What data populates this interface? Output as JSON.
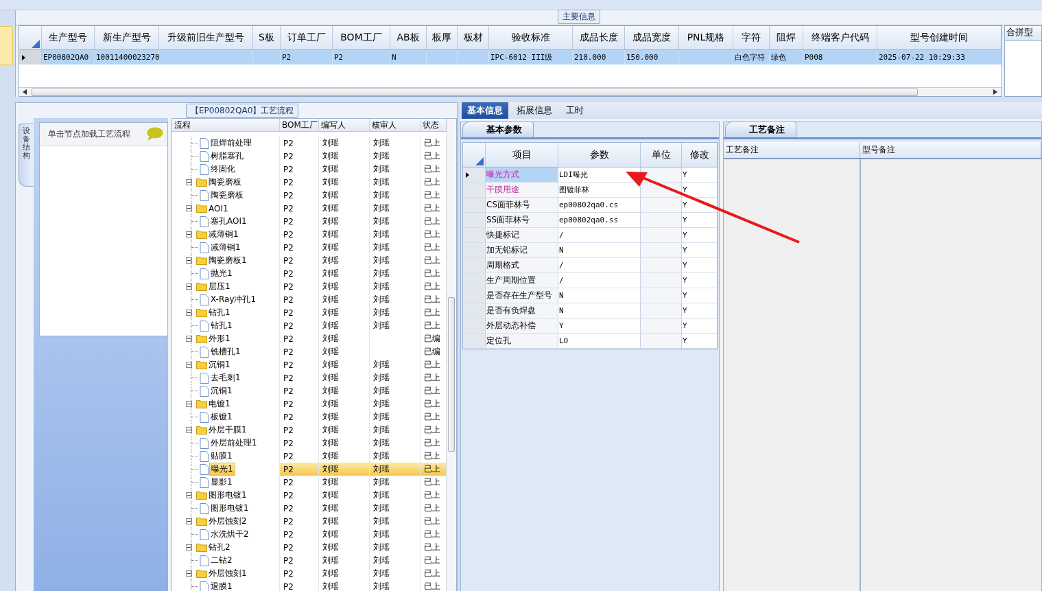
{
  "main_info": {
    "legend": "主要信息",
    "side_header": "合拼型",
    "columns": [
      "生产型号",
      "新生产型号",
      "升级前旧生产型号",
      "S板",
      "订单工厂",
      "BOM工厂",
      "AB板",
      "板厚",
      "板材",
      "验收标准",
      "成品长度",
      "成品宽度",
      "PNL规格",
      "字符",
      "阻焊",
      "终端客户代码",
      "型号创建时间"
    ],
    "rows": [
      {
        "selected": true,
        "cells": [
          "EP00802QA0",
          "10011400023270",
          null,
          null,
          "P2",
          "P2",
          "N",
          null,
          null,
          "IPC-6012 III级",
          "210.000",
          "150.000",
          null,
          "白色字符",
          "绿色",
          "P008",
          "2025-07-22 10:29:33"
        ]
      }
    ]
  },
  "process": {
    "legend": "【EP00802QA0】工艺流程",
    "side_tab": "设备结构",
    "hint": "单击节点加载工艺流程",
    "columns": [
      "流程",
      "BOM工厂",
      "编写人",
      "核审人",
      "状态"
    ],
    "tree": [
      {
        "children": [
          {
            "label": "阻焊前处理",
            "bom": "P2",
            "writer": "刘瑶",
            "reviewer": "刘瑶",
            "status": "已上",
            "selected": false
          },
          {
            "label": "树脂塞孔",
            "bom": "P2",
            "writer": "刘瑶",
            "reviewer": "刘瑶",
            "status": "已上",
            "selected": false
          },
          {
            "label": "终固化",
            "bom": "P2",
            "writer": "刘瑶",
            "reviewer": "刘瑶",
            "status": "已上",
            "selected": false
          }
        ]
      },
      {
        "label": "陶瓷磨板",
        "bom": "P2",
        "writer": "刘瑶",
        "reviewer": "刘瑶",
        "status": "已上",
        "selected": false,
        "expanded": true,
        "children": [
          {
            "label": "陶瓷磨板",
            "bom": "P2",
            "writer": "刘瑶",
            "reviewer": "刘瑶",
            "status": "已上",
            "selected": false
          }
        ]
      },
      {
        "label": "AOI1",
        "bom": "P2",
        "writer": "刘瑶",
        "reviewer": "刘瑶",
        "status": "已上",
        "selected": false,
        "expanded": true,
        "children": [
          {
            "label": "塞孔AOI1",
            "bom": "P2",
            "writer": "刘瑶",
            "reviewer": "刘瑶",
            "status": "已上",
            "selected": false
          }
        ]
      },
      {
        "label": "减薄铜1",
        "bom": "P2",
        "writer": "刘瑶",
        "reviewer": "刘瑶",
        "status": "已上",
        "selected": false,
        "expanded": true,
        "children": [
          {
            "label": "减薄铜1",
            "bom": "P2",
            "writer": "刘瑶",
            "reviewer": "刘瑶",
            "status": "已上",
            "selected": false
          }
        ]
      },
      {
        "label": "陶瓷磨板1",
        "bom": "P2",
        "writer": "刘瑶",
        "reviewer": "刘瑶",
        "status": "已上",
        "selected": false,
        "expanded": true,
        "children": [
          {
            "label": "抛光1",
            "bom": "P2",
            "writer": "刘瑶",
            "reviewer": "刘瑶",
            "status": "已上",
            "selected": false
          }
        ]
      },
      {
        "label": "层压1",
        "bom": "P2",
        "writer": "刘瑶",
        "reviewer": "刘瑶",
        "status": "已上",
        "selected": false,
        "expanded": true,
        "children": [
          {
            "label": "X-Ray冲孔1",
            "bom": "P2",
            "writer": "刘瑶",
            "reviewer": "刘瑶",
            "status": "已上",
            "selected": false
          }
        ]
      },
      {
        "label": "钻孔1",
        "bom": "P2",
        "writer": "刘瑶",
        "reviewer": "刘瑶",
        "status": "已上",
        "selected": false,
        "expanded": true,
        "children": [
          {
            "label": "钻孔1",
            "bom": "P2",
            "writer": "刘瑶",
            "reviewer": "刘瑶",
            "status": "已上",
            "selected": false
          }
        ]
      },
      {
        "label": "外形1",
        "bom": "P2",
        "writer": "刘瑶",
        "status": "已编",
        "selected": false,
        "expanded": true,
        "children": [
          {
            "label": "铣槽孔1",
            "bom": "P2",
            "writer": "刘瑶",
            "status": "已编",
            "selected": false
          }
        ]
      },
      {
        "label": "沉铜1",
        "bom": "P2",
        "writer": "刘瑶",
        "reviewer": "刘瑶",
        "status": "已上",
        "selected": false,
        "expanded": true,
        "children": [
          {
            "label": "去毛刺1",
            "bom": "P2",
            "writer": "刘瑶",
            "reviewer": "刘瑶",
            "status": "已上",
            "selected": false
          },
          {
            "label": "沉铜1",
            "bom": "P2",
            "writer": "刘瑶",
            "reviewer": "刘瑶",
            "status": "已上",
            "selected": false
          }
        ]
      },
      {
        "label": "电镀1",
        "bom": "P2",
        "writer": "刘瑶",
        "reviewer": "刘瑶",
        "status": "已上",
        "selected": false,
        "expanded": true,
        "children": [
          {
            "label": "板镀1",
            "bom": "P2",
            "writer": "刘瑶",
            "reviewer": "刘瑶",
            "status": "已上",
            "selected": false
          }
        ]
      },
      {
        "label": "外层干膜1",
        "bom": "P2",
        "writer": "刘瑶",
        "reviewer": "刘瑶",
        "status": "已上",
        "selected": false,
        "expanded": true,
        "children": [
          {
            "label": "外层前处理1",
            "bom": "P2",
            "writer": "刘瑶",
            "reviewer": "刘瑶",
            "status": "已上",
            "selected": false
          },
          {
            "label": "贴膜1",
            "bom": "P2",
            "writer": "刘瑶",
            "reviewer": "刘瑶",
            "status": "已上",
            "selected": false
          },
          {
            "label": "曝光1",
            "bom": "P2",
            "writer": "刘瑶",
            "reviewer": "刘瑶",
            "status": "已上",
            "selected": true
          },
          {
            "label": "显影1",
            "bom": "P2",
            "writer": "刘瑶",
            "reviewer": "刘瑶",
            "status": "已上",
            "selected": false
          }
        ]
      },
      {
        "label": "图形电镀1",
        "bom": "P2",
        "writer": "刘瑶",
        "reviewer": "刘瑶",
        "status": "已上",
        "selected": false,
        "expanded": true,
        "children": [
          {
            "label": "图形电镀1",
            "bom": "P2",
            "writer": "刘瑶",
            "reviewer": "刘瑶",
            "status": "已上",
            "selected": false
          }
        ]
      },
      {
        "label": "外层蚀刻2",
        "bom": "P2",
        "writer": "刘瑶",
        "reviewer": "刘瑶",
        "status": "已上",
        "selected": false,
        "expanded": true,
        "children": [
          {
            "label": "水洗烘干2",
            "bom": "P2",
            "writer": "刘瑶",
            "reviewer": "刘瑶",
            "status": "已上",
            "selected": false
          }
        ]
      },
      {
        "label": "钻孔2",
        "bom": "P2",
        "writer": "刘瑶",
        "reviewer": "刘瑶",
        "status": "已上",
        "selected": false,
        "expanded": true,
        "children": [
          {
            "label": "二钻2",
            "bom": "P2",
            "writer": "刘瑶",
            "reviewer": "刘瑶",
            "status": "已上",
            "selected": false
          }
        ]
      },
      {
        "label": "外层蚀刻1",
        "bom": "P2",
        "writer": "刘瑶",
        "reviewer": "刘瑶",
        "status": "已上",
        "selected": false,
        "expanded": true,
        "children": [
          {
            "label": "退膜1",
            "bom": "P2",
            "writer": "刘瑶",
            "reviewer": "刘瑶",
            "status": "已上",
            "selected": false
          }
        ]
      }
    ]
  },
  "detail_tabs": [
    {
      "label": "基本信息",
      "selected": true
    },
    {
      "label": "拓展信息",
      "selected": false
    },
    {
      "label": "工时",
      "selected": false
    }
  ],
  "params": {
    "tab": "基本参数",
    "columns": [
      "项目",
      "参数",
      "单位",
      "修改"
    ],
    "rows": [
      {
        "item": "曝光方式",
        "value": "LDI曝光",
        "modified": "Y",
        "highlighted": true,
        "selected": true
      },
      {
        "item": "干膜用途",
        "value": "图镀菲林",
        "modified": "Y",
        "highlighted": true,
        "selected": false
      },
      {
        "item": "CS面菲林号",
        "value": "ep00802qa0.cs",
        "modified": "Y",
        "highlighted": false,
        "selected": false
      },
      {
        "item": "SS面菲林号",
        "value": "ep00802qa0.ss",
        "modified": "Y",
        "highlighted": false,
        "selected": false
      },
      {
        "item": "快捷标记",
        "value": "/",
        "modified": "Y",
        "highlighted": false,
        "selected": false
      },
      {
        "item": "加无铅标记",
        "value": "N",
        "modified": "Y",
        "highlighted": false,
        "selected": false
      },
      {
        "item": "周期格式",
        "value": "/",
        "modified": "Y",
        "highlighted": false,
        "selected": false
      },
      {
        "item": "生产周期位置",
        "value": "/",
        "modified": "Y",
        "highlighted": false,
        "selected": false
      },
      {
        "item": "是否存在生产型号",
        "value": "N",
        "modified": "Y",
        "highlighted": false,
        "selected": false
      },
      {
        "item": "是否有负焊盘",
        "value": "N",
        "modified": "Y",
        "highlighted": false,
        "selected": false
      },
      {
        "item": "外层动态补偿",
        "value": "Y",
        "modified": "Y",
        "highlighted": false,
        "selected": false
      },
      {
        "item": "定位孔",
        "value": "LO",
        "modified": "Y",
        "highlighted": false,
        "selected": false
      }
    ]
  },
  "notes": {
    "tab": "工艺备注",
    "columns": [
      "工艺备注",
      "型号备注"
    ]
  }
}
